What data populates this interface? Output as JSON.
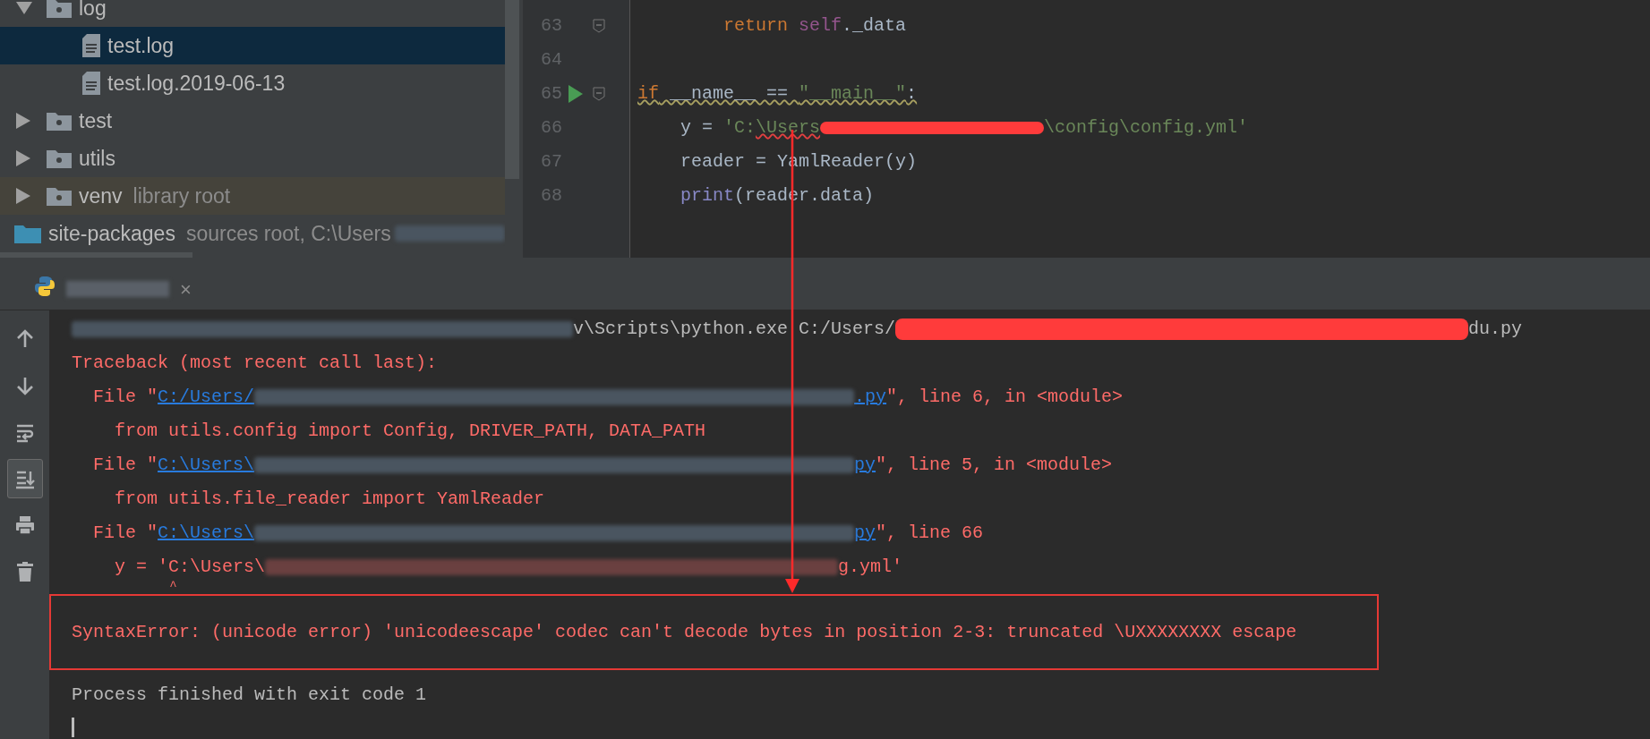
{
  "project_tree": {
    "items": [
      {
        "label": "log",
        "kind": "folder",
        "expanded": true,
        "selected": false,
        "children": [
          {
            "label": "test.log",
            "kind": "file",
            "selected": true
          },
          {
            "label": "test.log.2019-06-13",
            "kind": "file",
            "selected": false
          }
        ]
      },
      {
        "label": "test",
        "kind": "folder",
        "expanded": false,
        "selected": false
      },
      {
        "label": "utils",
        "kind": "folder",
        "expanded": false,
        "selected": false
      },
      {
        "label": "venv",
        "note": "library root",
        "kind": "library",
        "expanded": false,
        "selected": false
      },
      {
        "label": "site-packages",
        "note": "sources root, C:\\Users",
        "kind": "source",
        "selected": false
      }
    ]
  },
  "editor": {
    "lines": [
      {
        "number": "63",
        "fold": true,
        "run": false,
        "warning": false,
        "segments": [
          {
            "kind": "keyword",
            "text": "        return"
          },
          {
            "kind": "self",
            "text": " self"
          },
          {
            "kind": "plain",
            "text": "._data"
          }
        ]
      },
      {
        "number": "64",
        "fold": false,
        "run": false,
        "warning": false
      },
      {
        "number": "65",
        "fold": true,
        "run": true,
        "warning": true,
        "segments": [
          {
            "kind": "keyword",
            "text": "if"
          },
          {
            "kind": "plain",
            "text": " __name__ == "
          },
          {
            "kind": "string",
            "text": "\"__main__\""
          },
          {
            "kind": "plain",
            "text": ":"
          }
        ]
      },
      {
        "number": "66",
        "fold": false,
        "run": false,
        "warning": false,
        "segments": [
          {
            "kind": "plain",
            "text": "    y = "
          },
          {
            "kind": "string",
            "text": "'C:"
          },
          {
            "kind": "string",
            "text": "\\Users",
            "typo": true
          },
          {
            "kind": "scribble"
          },
          {
            "kind": "string",
            "text": "\\config\\config.yml'"
          }
        ]
      },
      {
        "number": "67",
        "fold": false,
        "run": false,
        "warning": false,
        "segments": [
          {
            "kind": "plain",
            "text": "    reader = YamlReader(y)"
          }
        ]
      },
      {
        "number": "68",
        "fold": false,
        "run": false,
        "warning": false,
        "segments": [
          {
            "kind": "builtin",
            "text": "    print"
          },
          {
            "kind": "plain",
            "text": "(reader.data)"
          }
        ]
      }
    ]
  },
  "run_panel": {
    "tab": {
      "close": "×"
    },
    "tools": [
      {
        "kind": "up",
        "on": false
      },
      {
        "kind": "down",
        "on": false
      },
      {
        "kind": "wrap",
        "on": false
      },
      {
        "kind": "scroll_end",
        "on": true
      },
      {
        "kind": "print",
        "on": false
      },
      {
        "kind": "trash",
        "on": false
      }
    ],
    "lines": [
      {
        "highlighted": false,
        "segments": [
          {
            "kind": "blur"
          },
          {
            "kind": "plain",
            "text": "v\\Scripts\\python.exe C:/Users/"
          },
          {
            "kind": "scribble"
          },
          {
            "kind": "plain",
            "text": "du.py"
          }
        ]
      },
      {
        "highlighted": false,
        "segments": [
          {
            "kind": "error",
            "text": "Traceback (most recent call last):"
          }
        ]
      },
      {
        "highlighted": false,
        "segments": [
          {
            "kind": "error",
            "text": "  File \""
          },
          {
            "kind": "link",
            "text": "C:/Users/"
          },
          {
            "kind": "blur"
          },
          {
            "kind": "link",
            "text": ".py"
          },
          {
            "kind": "error",
            "text": "\", line 6, in <module>"
          }
        ]
      },
      {
        "highlighted": false,
        "segments": [
          {
            "kind": "error",
            "text": "    from utils.config import Config, DRIVER_PATH, DATA_PATH"
          }
        ]
      },
      {
        "highlighted": false,
        "segments": [
          {
            "kind": "error",
            "text": "  File \""
          },
          {
            "kind": "link",
            "text": "C:\\Users\\"
          },
          {
            "kind": "blur"
          },
          {
            "kind": "link",
            "text": "py"
          },
          {
            "kind": "error",
            "text": "\", line 5, in <module>"
          }
        ]
      },
      {
        "highlighted": false,
        "segments": [
          {
            "kind": "error",
            "text": "    from utils.file_reader import YamlReader"
          }
        ]
      },
      {
        "highlighted": false,
        "segments": [
          {
            "kind": "error",
            "text": "  File \""
          },
          {
            "kind": "link",
            "text": "C:\\Users\\"
          },
          {
            "kind": "blur"
          },
          {
            "kind": "link",
            "text": "py"
          },
          {
            "kind": "error",
            "text": "\", line 66"
          }
        ]
      },
      {
        "highlighted": false,
        "segments": [
          {
            "kind": "error",
            "text": "    y = 'C:\\Users\\"
          },
          {
            "kind": "redblur"
          },
          {
            "kind": "error",
            "text": "g.yml'"
          }
        ]
      },
      {
        "highlighted": false,
        "caret": true,
        "segments": [
          {
            "kind": "error",
            "text": "             ^"
          }
        ]
      },
      {
        "highlighted": true,
        "segments": [
          {
            "kind": "error",
            "text": "SyntaxError: (unicode error) 'unicodeescape' codec can't decode bytes in position 2-3: truncated \\UXXXXXXXX escape"
          }
        ]
      },
      {
        "highlighted": false,
        "segments": [
          {
            "kind": "plain",
            "text": "Process finished with exit code 1"
          }
        ]
      }
    ]
  }
}
